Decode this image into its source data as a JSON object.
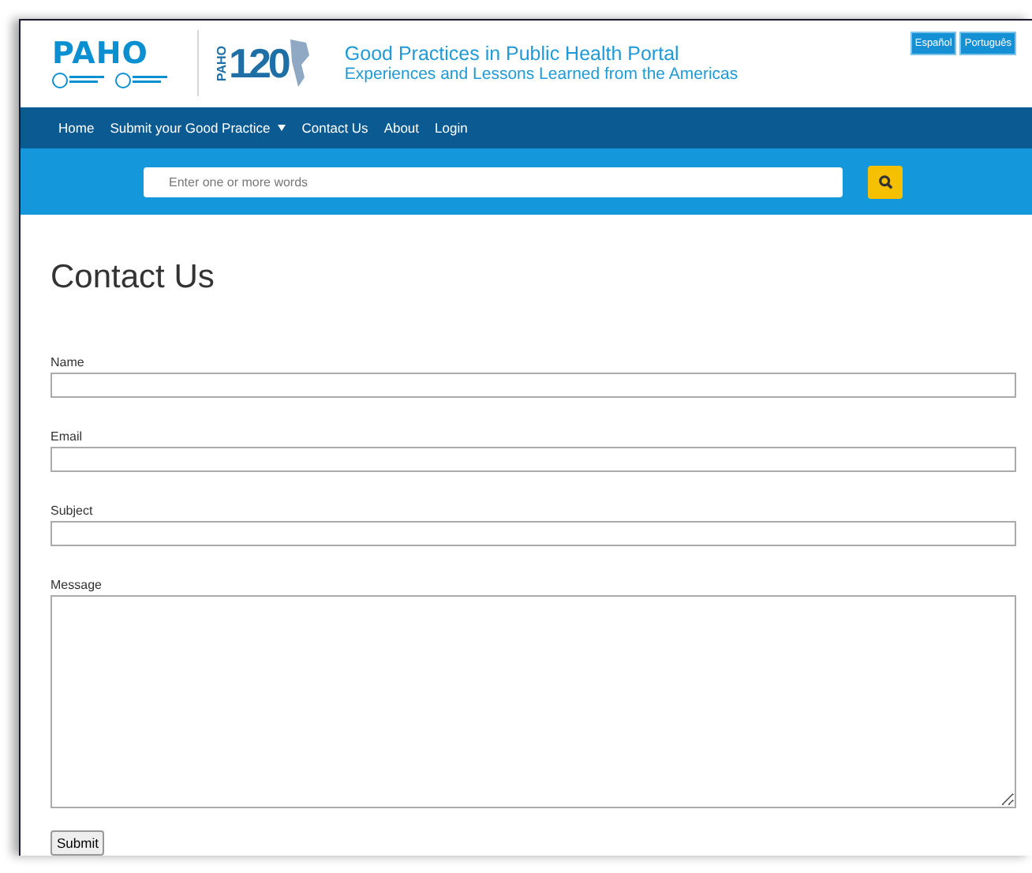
{
  "header": {
    "logo": "PAHO",
    "anniversary_logo": {
      "side": "PAHO",
      "number": "120"
    },
    "title": "Good Practices in Public Health Portal",
    "subtitle": "Experiences and Lessons Learned from the Americas",
    "languages": [
      "Español",
      "Português"
    ]
  },
  "nav": [
    {
      "label": "Home",
      "dropdown": false
    },
    {
      "label": "Submit your Good Practice",
      "dropdown": true
    },
    {
      "label": "Contact Us",
      "dropdown": false
    },
    {
      "label": "About",
      "dropdown": false
    },
    {
      "label": "Login",
      "dropdown": false
    }
  ],
  "search": {
    "placeholder": "Enter one or more words"
  },
  "page_title": "Contact Us",
  "form": {
    "fields": [
      {
        "label": "Name",
        "kind": "input"
      },
      {
        "label": "Email",
        "kind": "input"
      },
      {
        "label": "Subject",
        "kind": "input"
      },
      {
        "label": "Message",
        "kind": "textarea"
      }
    ],
    "submit": "Submit"
  }
}
